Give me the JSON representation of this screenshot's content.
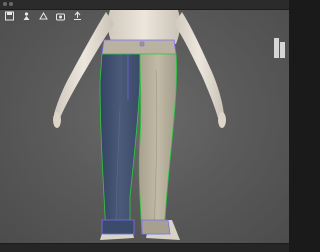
{
  "window": {
    "title": ""
  },
  "toolbar": {
    "tools": [
      {
        "icon": "save-icon",
        "label": ""
      },
      {
        "icon": "simulate-icon",
        "label": ""
      },
      {
        "icon": "render-icon",
        "label": ""
      },
      {
        "icon": "snapshot-icon",
        "label": ""
      },
      {
        "icon": "export-icon",
        "label": ""
      }
    ]
  },
  "brand": {
    "logo": "brand-logo-icon",
    "caption": ""
  },
  "scene": {
    "avatar": "female-avatar",
    "garment": "two-tone-pants",
    "colors": {
      "background": "#5b5b5b",
      "skin": "#e7e0d6",
      "denim": "#3f4f6a",
      "fabric_light": "#b4ad99",
      "outline_green": "#2ecc40",
      "outline_purple": "#7a6cff"
    }
  },
  "status": {
    "text": ""
  }
}
